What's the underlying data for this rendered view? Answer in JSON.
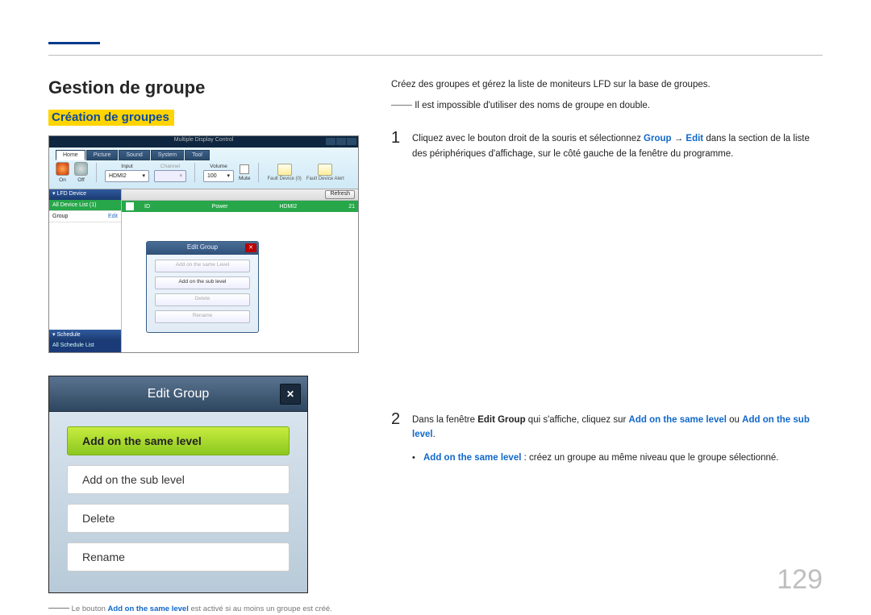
{
  "page_number": "129",
  "header": {
    "section_title": "Gestion de groupe",
    "subsection_title_hl": "Création de groupes"
  },
  "right": {
    "intro": "Créez des groupes et gérez la liste de moniteurs LFD sur la base de groupes.",
    "note_dash": "――",
    "note_text": "Il est impossible d'utiliser des noms de groupe en double.",
    "steps": [
      {
        "num": "1",
        "pre": "Cliquez avec le bouton droit de la souris et sélectionnez ",
        "b1": "Group",
        "arrow": " → ",
        "b2": "Edit",
        "post": " dans la section de la liste des périphériques d'affichage, sur le côté gauche de la fenêtre du programme."
      },
      {
        "num": "2",
        "pre": "Dans la fenêtre ",
        "b1": "Edit Group",
        "mid": " qui s'affiche, cliquez sur ",
        "b2": "Add on the same level",
        "mid2": " ou ",
        "b3": "Add on the sub level",
        "post": "."
      }
    ],
    "bullet": {
      "b1": "Add on the same level",
      "text": " : créez un groupe au même niveau que le groupe sélectionné."
    }
  },
  "ss1": {
    "window_title": "Multiple Display Control",
    "tabs": [
      "Home",
      "Picture",
      "Sound",
      "System",
      "Tool"
    ],
    "on_label": "On",
    "off_label": "Off",
    "input_label": "Input",
    "input_value": "HDMI2",
    "channel_label": "Channel",
    "volume_label": "Volume",
    "volume_value": "100",
    "mute_label": "Mute",
    "fault_id": "Fault Device (0)",
    "fault_alert": "Fault Device Alert",
    "side_lfd": "▾  LFD Device",
    "side_all": "All Device List (1)",
    "side_group": "Group",
    "side_edit": "Edit",
    "side_schedule": "▾  Schedule",
    "side_schedule_all": "All Schedule List",
    "refresh": "Refresh",
    "green_cols": {
      "id": "ID",
      "pwr": "Power",
      "input": "HDMI2",
      "val": "21"
    },
    "popup_title": "Edit Group",
    "popup_buttons": [
      "Add on the same Level",
      "Add on the sub level",
      "Delete",
      "Rename"
    ]
  },
  "ss2": {
    "title": "Edit Group",
    "buttons": [
      "Add on the same level",
      "Add on the sub level",
      "Delete",
      "Rename"
    ]
  },
  "footnote": {
    "dash": "――",
    "pre": "Le bouton ",
    "b1": "Add on the same level",
    "post": " est activé si au moins un groupe est créé."
  }
}
